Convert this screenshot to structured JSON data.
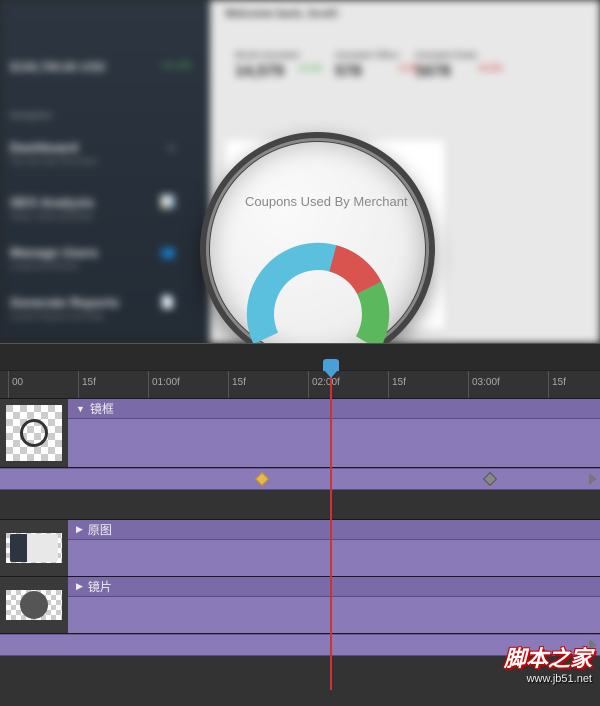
{
  "preview": {
    "welcome": "Welcome back, Scott!",
    "money": "$108,789.66 USD",
    "moneyPct": "+4.1%",
    "navLabel": "Navigation",
    "stats": [
      {
        "label": "Month Activated",
        "value": "14,579",
        "change": "+4.1%",
        "color": "#5cb85c"
      },
      {
        "label": "Activated Offers",
        "value": "578",
        "change": "+2.8%",
        "color": "#d9534f"
      },
      {
        "label": "Activated Deals",
        "value": "1678",
        "change": "+8.4%",
        "color": "#d9534f"
      }
    ],
    "navItems": [
      {
        "title": "Dashboard",
        "sub": "You Can Call This Home"
      },
      {
        "title": "SEO Analysis",
        "sub": "Views, Clicks And More"
      },
      {
        "title": "Manage Users",
        "sub": "Create And Review"
      },
      {
        "title": "Generate Reports",
        "sub": "Custom Reports And Stats"
      }
    ],
    "magnifierText": "Coupons Used By Merchant"
  },
  "ruler": [
    "00",
    "15f",
    "01:00f",
    "15f",
    "02:00f",
    "15f",
    "03:00f",
    "15f"
  ],
  "rulerPos": [
    8,
    78,
    148,
    228,
    308,
    388,
    468,
    548
  ],
  "playheadX": 330,
  "tracks": {
    "t1": "镜框",
    "t2": "原图",
    "t3": "镜片"
  },
  "watermark": {
    "cn": "脚本之家",
    "url": "www.jb51.net"
  }
}
